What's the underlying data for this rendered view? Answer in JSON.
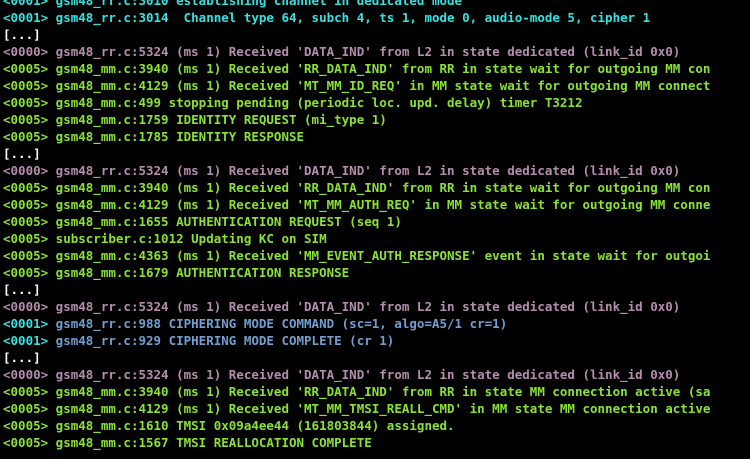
{
  "colors": {
    "background": "#000000",
    "cyan": "#34e2e2",
    "green": "#8ae234",
    "purple": "#b48ead",
    "blue": "#729fcf",
    "white": "#ffffff"
  },
  "lines": [
    {
      "tag": "<0001>",
      "text": " gsm48_rr.c:3010 establishing channel in dedicated mode",
      "tagColor": "cyan",
      "textColor": "cyan"
    },
    {
      "tag": "<0001>",
      "text": " gsm48_rr.c:3014  Channel type 64, subch 4, ts 1, mode 0, audio-mode 5, cipher 1",
      "tagColor": "cyan",
      "textColor": "cyan"
    },
    {
      "tag": "",
      "text": "[...]",
      "tagColor": "white",
      "textColor": "white"
    },
    {
      "tag": "<0000>",
      "text": " gsm48_rr.c:5324 (ms 1) Received 'DATA_IND' from L2 in state dedicated (link_id 0x0)",
      "tagColor": "purple",
      "textColor": "purple"
    },
    {
      "tag": "<0005>",
      "text": " gsm48_mm.c:3940 (ms 1) Received 'RR_DATA_IND' from RR in state wait for outgoing MM con",
      "tagColor": "green",
      "textColor": "green"
    },
    {
      "tag": "<0005>",
      "text": " gsm48_mm.c:4129 (ms 1) Received 'MT_MM_ID_REQ' in MM state wait for outgoing MM connect",
      "tagColor": "green",
      "textColor": "green"
    },
    {
      "tag": "<0005>",
      "text": " gsm48_mm.c:499 stopping pending (periodic loc. upd. delay) timer T3212",
      "tagColor": "green",
      "textColor": "green"
    },
    {
      "tag": "<0005>",
      "text": " gsm48_mm.c:1759 IDENTITY REQUEST (mi_type 1)",
      "tagColor": "green",
      "textColor": "green"
    },
    {
      "tag": "<0005>",
      "text": " gsm48_mm.c:1785 IDENTITY RESPONSE",
      "tagColor": "green",
      "textColor": "green"
    },
    {
      "tag": "",
      "text": "[...]",
      "tagColor": "white",
      "textColor": "white"
    },
    {
      "tag": "<0000>",
      "text": " gsm48_rr.c:5324 (ms 1) Received 'DATA_IND' from L2 in state dedicated (link_id 0x0)",
      "tagColor": "purple",
      "textColor": "purple"
    },
    {
      "tag": "<0005>",
      "text": " gsm48_mm.c:3940 (ms 1) Received 'RR_DATA_IND' from RR in state wait for outgoing MM con",
      "tagColor": "green",
      "textColor": "green"
    },
    {
      "tag": "<0005>",
      "text": " gsm48_mm.c:4129 (ms 1) Received 'MT_MM_AUTH_REQ' in MM state wait for outgoing MM conne",
      "tagColor": "green",
      "textColor": "green"
    },
    {
      "tag": "<0005>",
      "text": " gsm48_mm.c:1655 AUTHENTICATION REQUEST (seq 1)",
      "tagColor": "green",
      "textColor": "green"
    },
    {
      "tag": "<0005>",
      "text": " subscriber.c:1012 Updating KC on SIM",
      "tagColor": "green",
      "textColor": "green"
    },
    {
      "tag": "<0005>",
      "text": " gsm48_mm.c:4363 (ms 1) Received 'MM_EVENT_AUTH_RESPONSE' event in state wait for outgoi",
      "tagColor": "green",
      "textColor": "green"
    },
    {
      "tag": "<0005>",
      "text": " gsm48_mm.c:1679 AUTHENTICATION RESPONSE",
      "tagColor": "green",
      "textColor": "green"
    },
    {
      "tag": "",
      "text": "[...]",
      "tagColor": "white",
      "textColor": "white"
    },
    {
      "tag": "<0000>",
      "text": " gsm48_rr.c:5324 (ms 1) Received 'DATA_IND' from L2 in state dedicated (link_id 0x0)",
      "tagColor": "purple",
      "textColor": "purple"
    },
    {
      "tag": "<0001>",
      "text": " gsm48_rr.c:988 CIPHERING MODE COMMAND (sc=1, algo=A5/1 cr=1)",
      "tagColor": "cyan",
      "textColor": "blue"
    },
    {
      "tag": "<0001>",
      "text": " gsm48_rr.c:929 CIPHERING MODE COMPLETE (cr 1)",
      "tagColor": "cyan",
      "textColor": "blue"
    },
    {
      "tag": "",
      "text": "[...]",
      "tagColor": "white",
      "textColor": "white"
    },
    {
      "tag": "<0000>",
      "text": " gsm48_rr.c:5324 (ms 1) Received 'DATA_IND' from L2 in state dedicated (link_id 0x0)",
      "tagColor": "purple",
      "textColor": "purple"
    },
    {
      "tag": "<0005>",
      "text": " gsm48_mm.c:3940 (ms 1) Received 'RR_DATA_IND' from RR in state MM connection active (sa",
      "tagColor": "green",
      "textColor": "green"
    },
    {
      "tag": "<0005>",
      "text": " gsm48_mm.c:4129 (ms 1) Received 'MT_MM_TMSI_REALL_CMD' in MM state MM connection active",
      "tagColor": "green",
      "textColor": "green"
    },
    {
      "tag": "<0005>",
      "text": " gsm48_mm.c:1610 TMSI 0x09a4ee44 (161803844) assigned.",
      "tagColor": "green",
      "textColor": "green"
    },
    {
      "tag": "<0005>",
      "text": " gsm48_mm.c:1567 TMSI REALLOCATION COMPLETE",
      "tagColor": "green",
      "textColor": "green"
    }
  ]
}
